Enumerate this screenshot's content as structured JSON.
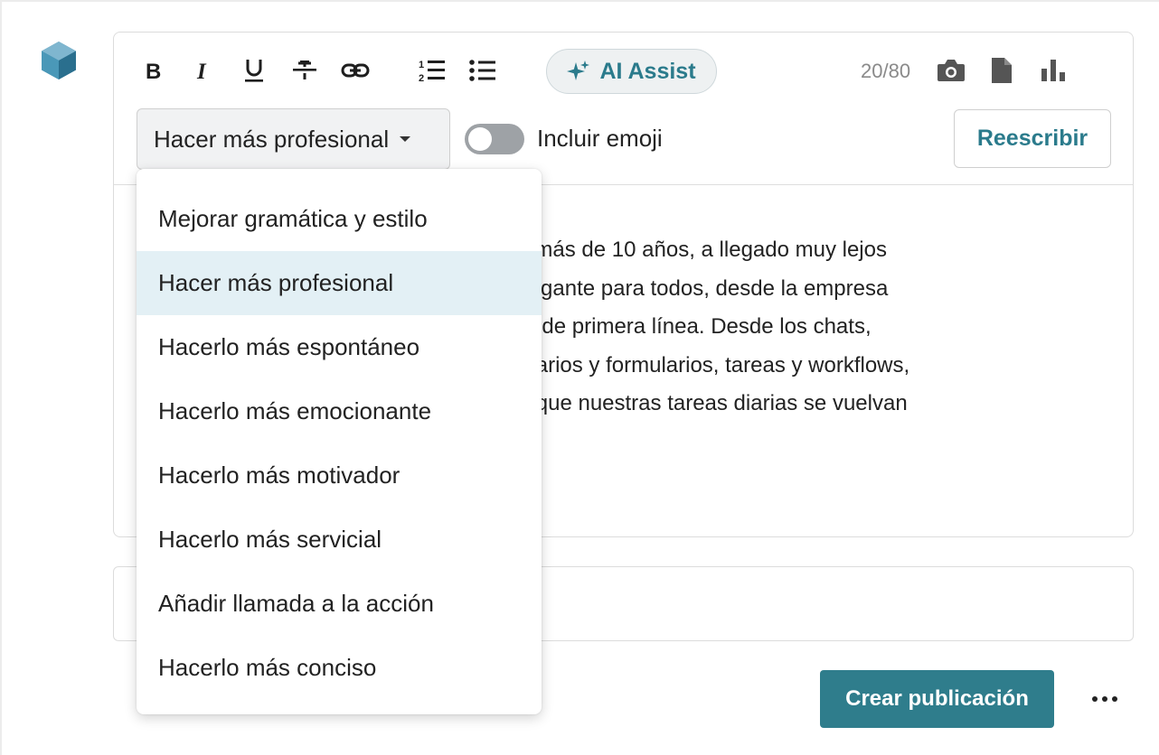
{
  "toolbar": {
    "icons": [
      "bold-icon",
      "italic-icon",
      "underline-icon",
      "strikethrough-icon",
      "link-icon",
      "ordered-list-icon",
      "bullet-list-icon"
    ],
    "ai_assist_label": "AI Assist",
    "char_counter": "20/80",
    "media_icons": [
      "camera-icon",
      "document-icon",
      "chart-icon"
    ]
  },
  "rewrite_panel": {
    "tone_selected": "Hacer más profesional",
    "emoji_toggle_label": "Incluir emoji",
    "emoji_toggle_on": false,
    "rewrite_button": "Reescribir"
  },
  "tone_menu": {
    "selected_index": 1,
    "options": [
      "Mejorar gramática y estilo",
      "Hacer más profesional",
      "Hacerlo más espontáneo",
      "Hacerlo más emocionante",
      "Hacerlo más motivador",
      "Hacerlo más servicial",
      "Añadir llamada a la acción",
      "Hacerlo más conciso"
    ]
  },
  "editor": {
    "visible_lines": [
      "pezó hace más de 10 años, a llegado muy lejos",
      "ormación gigante para todos, desde la empresa",
      "abajadores de primera línea. Desde los chats,",
      "uestas, horarios y formularios, tareas y workflows,",
      ", ha hecho que nuestras tareas diarias se vuelvan"
    ]
  },
  "actions": {
    "create_post": "Crear publicación"
  },
  "colors": {
    "accent": "#2f7d8c",
    "selected_option_bg": "#e3f0f5"
  }
}
